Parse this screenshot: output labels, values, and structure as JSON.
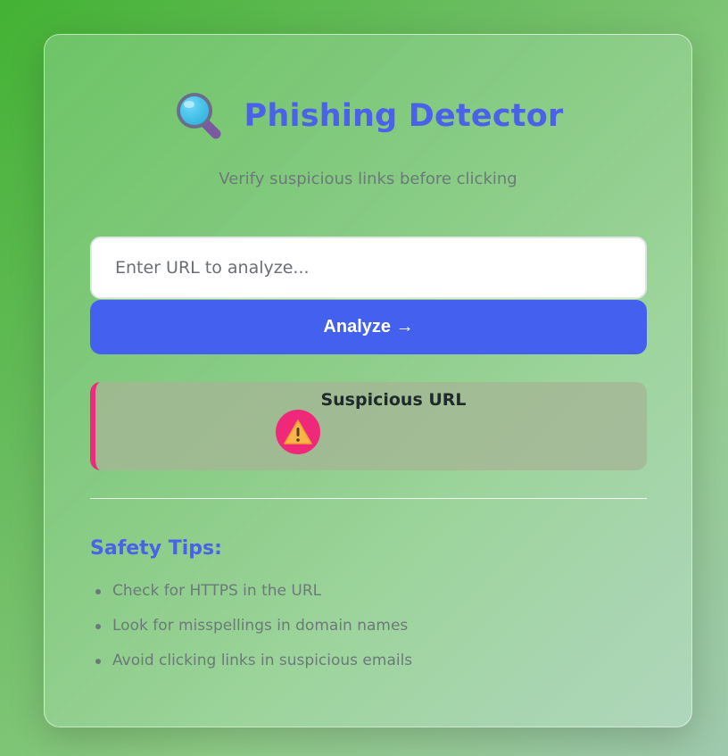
{
  "header": {
    "title": "Phishing Detector",
    "icon": "magnifying-glass-icon",
    "subtitle": "Verify suspicious links before clicking"
  },
  "form": {
    "url_placeholder": "Enter URL to analyze...",
    "url_value": "",
    "analyze_label": "Analyze →"
  },
  "result": {
    "icon": "warning-icon",
    "label": "Suspicious URL",
    "accent_color": "#ee2a7b"
  },
  "tips": {
    "title": "Safety Tips:",
    "items": [
      "Check for HTTPS in the URL",
      "Look for misspellings in domain names",
      "Avoid clicking links in suspicious emails"
    ]
  },
  "colors": {
    "primary": "#4361ee",
    "title": "#4a62ea",
    "muted_text": "#6b7a78",
    "warning_badge": "#f0287a"
  }
}
